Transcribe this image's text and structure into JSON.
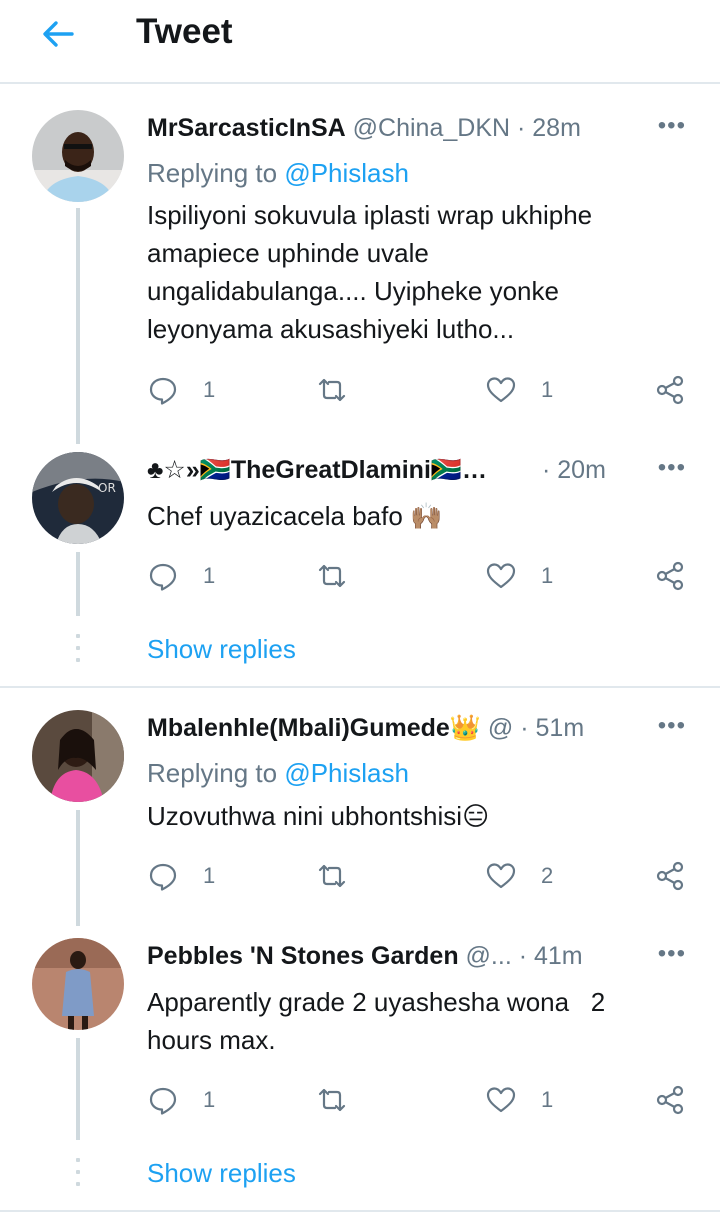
{
  "header": {
    "title": "Tweet"
  },
  "tweets": [
    {
      "name": "MrSarcasticInSA",
      "handle": "@China_DKN",
      "time": "· 28m",
      "reply_prefix": "Replying to",
      "reply_mention": "@Phislash",
      "lines": [
        "Ispiliyoni sokuvula iplasti wrap ukhiphe",
        "amapiece uphinde uvale",
        "ungalidabulanga.... Uyipheke yonke",
        "leyonyama akusashiyeki lutho..."
      ],
      "replies": "1",
      "likes": "1",
      "more": "•••"
    },
    {
      "name": "♣☆»🇿🇦TheGreatDlamini🇿🇦…",
      "handle": "",
      "time": "· 20m",
      "lines": [
        "Chef uyazicacela bafo 🙌🏽"
      ],
      "replies": "1",
      "likes": "1",
      "more": "•••"
    },
    {
      "name": "Mbalenhle(Mbali)Gumede👑",
      "handle": "@",
      "time": "· 51m",
      "reply_prefix": "Replying to",
      "reply_mention": "@Phislash",
      "lines": [
        "Uzovuthwa nini ubhontshisi😑"
      ],
      "replies": "1",
      "likes": "2",
      "more": "•••"
    },
    {
      "name": "Pebbles 'N Stones Garden",
      "handle": "@...",
      "time": " · 41m",
      "lines": [
        "Apparently grade 2 uyashesha wona   2",
        "hours max."
      ],
      "replies": "1",
      "likes": "1",
      "more": "•••"
    }
  ],
  "show_replies": "Show replies",
  "colors": {
    "accent": "#1da1f2",
    "muted": "#657786",
    "border": "#e1e8ed"
  },
  "icons": [
    "back-arrow-icon",
    "reply-icon",
    "retweet-icon",
    "like-icon",
    "share-icon",
    "more-icon"
  ]
}
